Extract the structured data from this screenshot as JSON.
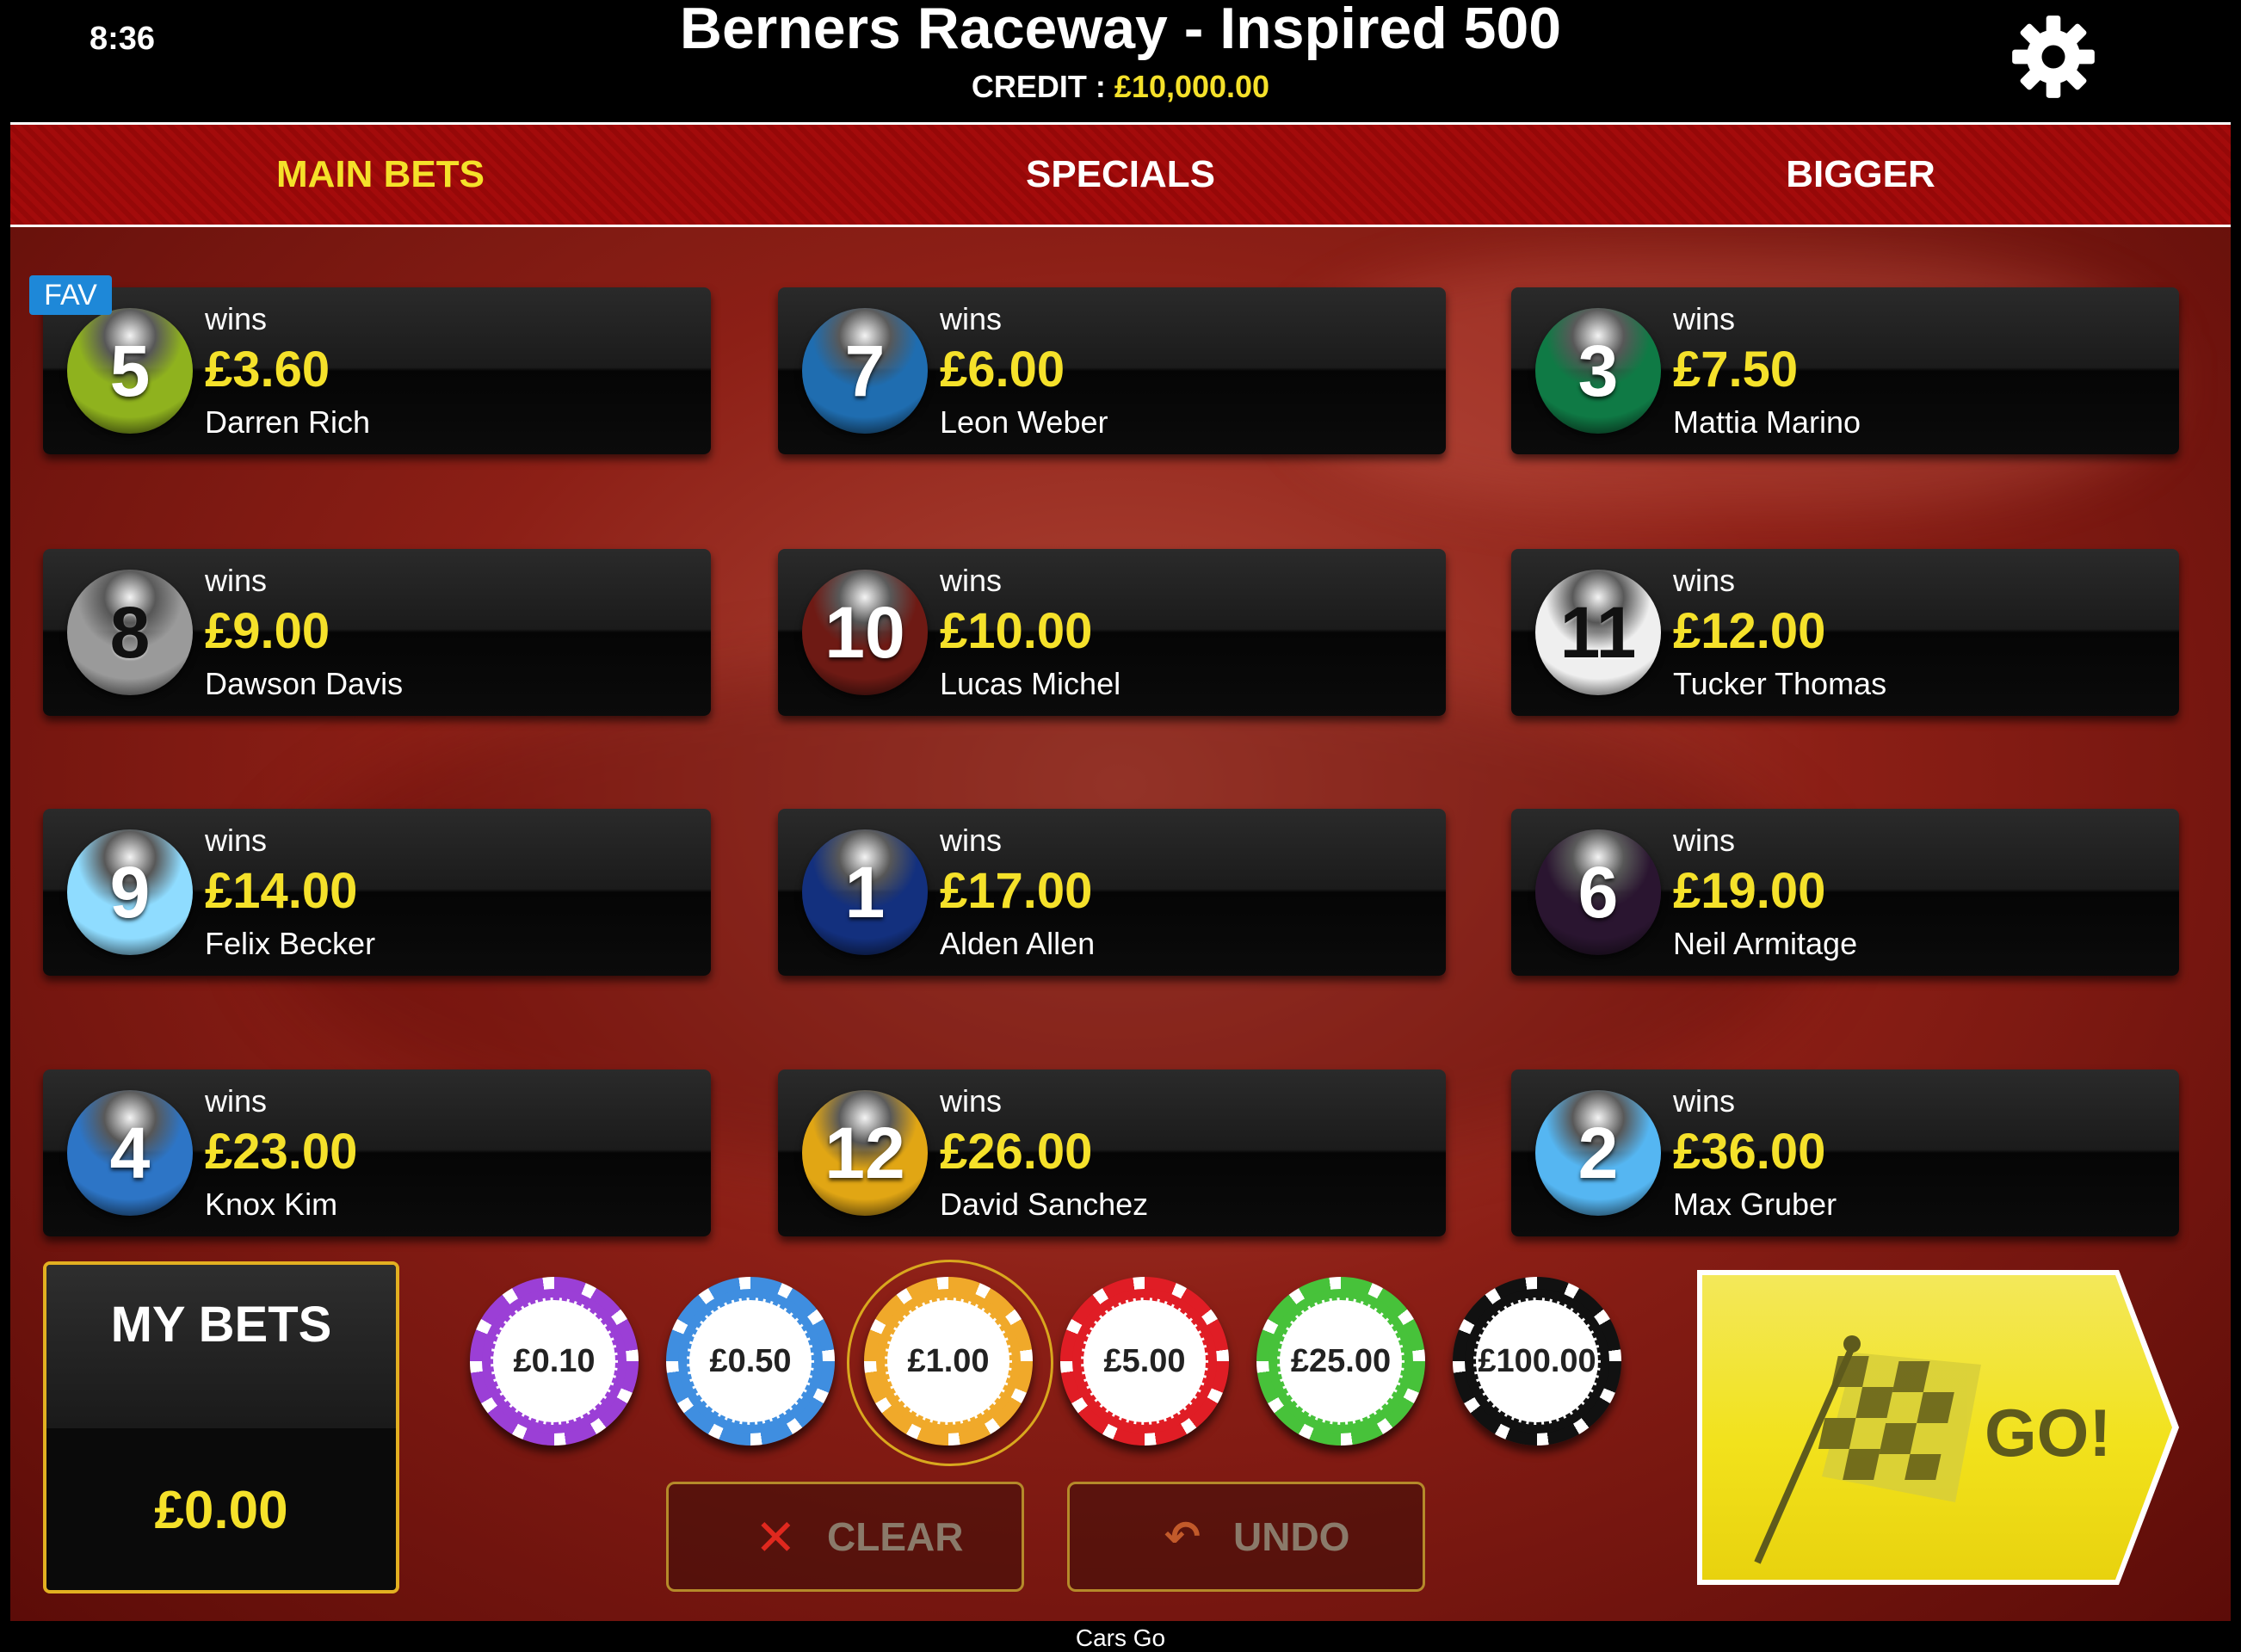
{
  "header": {
    "time": "8:36",
    "title": "Berners Raceway - Inspired 500",
    "credit_label": "CREDIT :",
    "credit_value": "£10,000.00"
  },
  "tabs": [
    {
      "label": "MAIN BETS",
      "active": true
    },
    {
      "label": "SPECIALS",
      "active": false
    },
    {
      "label": "BIGGER",
      "active": false
    }
  ],
  "favourite_badge": "FAV",
  "bets": [
    {
      "number": "5",
      "wins_label": "wins",
      "price": "£3.60",
      "runner": "Darren Rich",
      "ball_color": "#8fb21e"
    },
    {
      "number": "7",
      "wins_label": "wins",
      "price": "£6.00",
      "runner": "Leon Weber",
      "ball_color": "#1f6db0"
    },
    {
      "number": "3",
      "wins_label": "wins",
      "price": "£7.50",
      "runner": "Mattia Marino",
      "ball_color": "#0f7a45"
    },
    {
      "number": "8",
      "wins_label": "wins",
      "price": "£9.00",
      "runner": "Dawson Davis",
      "ball_color": "#9a9a9a"
    },
    {
      "number": "10",
      "wins_label": "wins",
      "price": "£10.00",
      "runner": "Lucas Michel",
      "ball_color": "#6e1a14"
    },
    {
      "number": "11",
      "wins_label": "wins",
      "price": "£12.00",
      "runner": "Tucker Thomas",
      "ball_color": "#efefef"
    },
    {
      "number": "9",
      "wins_label": "wins",
      "price": "£14.00",
      "runner": "Felix Becker",
      "ball_color": "#8fdcff"
    },
    {
      "number": "1",
      "wins_label": "wins",
      "price": "£17.00",
      "runner": "Alden Allen",
      "ball_color": "#13307e"
    },
    {
      "number": "6",
      "wins_label": "wins",
      "price": "£19.00",
      "runner": "Neil Armitage",
      "ball_color": "#2a1530"
    },
    {
      "number": "4",
      "wins_label": "wins",
      "price": "£23.00",
      "runner": "Knox Kim",
      "ball_color": "#2d75c6"
    },
    {
      "number": "12",
      "wins_label": "wins",
      "price": "£26.00",
      "runner": "David Sanchez",
      "ball_color": "#e1a614"
    },
    {
      "number": "2",
      "wins_label": "wins",
      "price": "£36.00",
      "runner": "Max Gruber",
      "ball_color": "#55b6f2"
    }
  ],
  "my_bets": {
    "label": "MY BETS",
    "amount": "£0.00"
  },
  "chips": [
    {
      "value": "£0.10",
      "color": "#9b3fd6",
      "selected": false
    },
    {
      "value": "£0.50",
      "color": "#3f8ee0",
      "selected": false
    },
    {
      "value": "£1.00",
      "color": "#f0a92a",
      "selected": true
    },
    {
      "value": "£5.00",
      "color": "#e01d25",
      "selected": false
    },
    {
      "value": "£25.00",
      "color": "#47c23a",
      "selected": false
    },
    {
      "value": "£100.00",
      "color": "#111111",
      "selected": false
    }
  ],
  "controls": {
    "clear_label": "CLEAR",
    "undo_label": "UNDO"
  },
  "go_label": "GO!",
  "footer_text": "Cars Go",
  "colors": {
    "accent_yellow": "#f5e12a",
    "tab_red": "#a30b0b",
    "gold_border": "#e3b021"
  }
}
